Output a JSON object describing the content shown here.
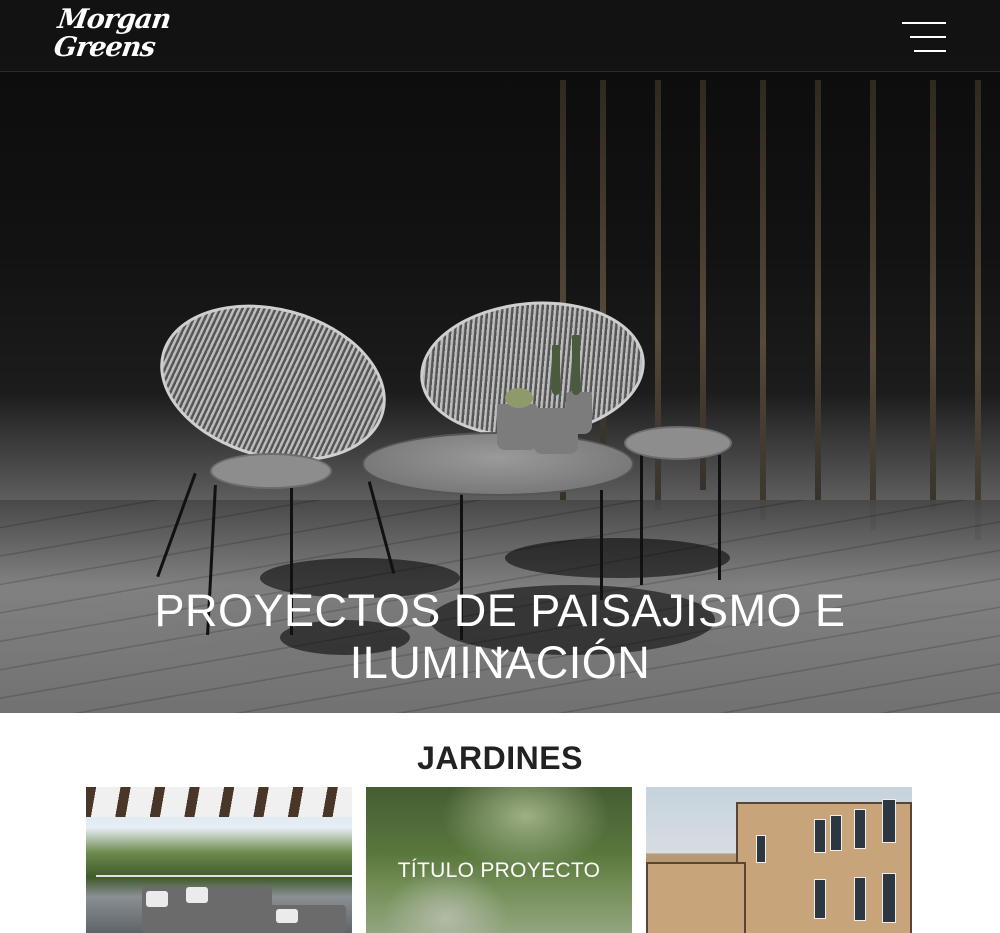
{
  "header": {
    "logo_line1": "Morgan",
    "logo_line2": "Greens",
    "menu_icon": "hamburger-menu-icon"
  },
  "hero": {
    "title": "PROYECTOS DE PAISAJISMO E ILUMINACIÓN",
    "scroll_icon": "chevron-down-icon"
  },
  "section": {
    "title": "JARDINES",
    "projects": [
      {
        "label": ""
      },
      {
        "label": "TÍTULO PROYECTO"
      },
      {
        "label": ""
      }
    ]
  },
  "colors": {
    "nav_background": "#141414",
    "text_light": "#ffffff",
    "text_dark": "#222222"
  }
}
